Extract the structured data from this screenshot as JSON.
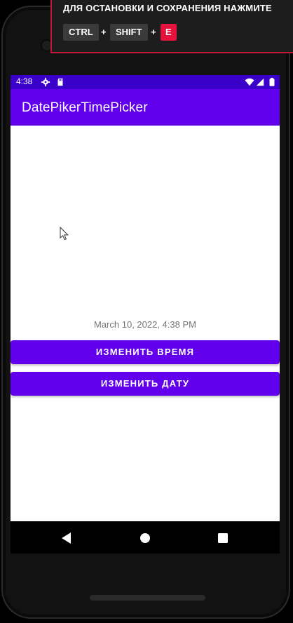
{
  "overlay": {
    "instruction": "ДЛЯ ОСТАНОВКИ И СОХРАНЕНИЯ НАЖМИТЕ",
    "keys": [
      "CTRL",
      "SHIFT",
      "E"
    ],
    "plus": "+"
  },
  "statusbar": {
    "time": "4:38",
    "icons": [
      "settings-icon",
      "sd-card-icon",
      "wifi-icon",
      "signal-icon",
      "battery-icon"
    ]
  },
  "app": {
    "title": "DatePikerTimePicker"
  },
  "content": {
    "datetime": "March 10, 2022, 4:38 PM",
    "change_time_button": "ИЗМЕНИТЬ ВРЕМЯ",
    "change_date_button": "ИЗМЕНИТЬ ДАТУ"
  },
  "navbar": {
    "icons": [
      "back-icon",
      "home-icon",
      "recents-icon"
    ]
  },
  "colors": {
    "primary": "#6200ee",
    "primary_dark": "#3a00c9",
    "overlay_border": "#c4153a",
    "key_highlight": "#e4123c"
  }
}
